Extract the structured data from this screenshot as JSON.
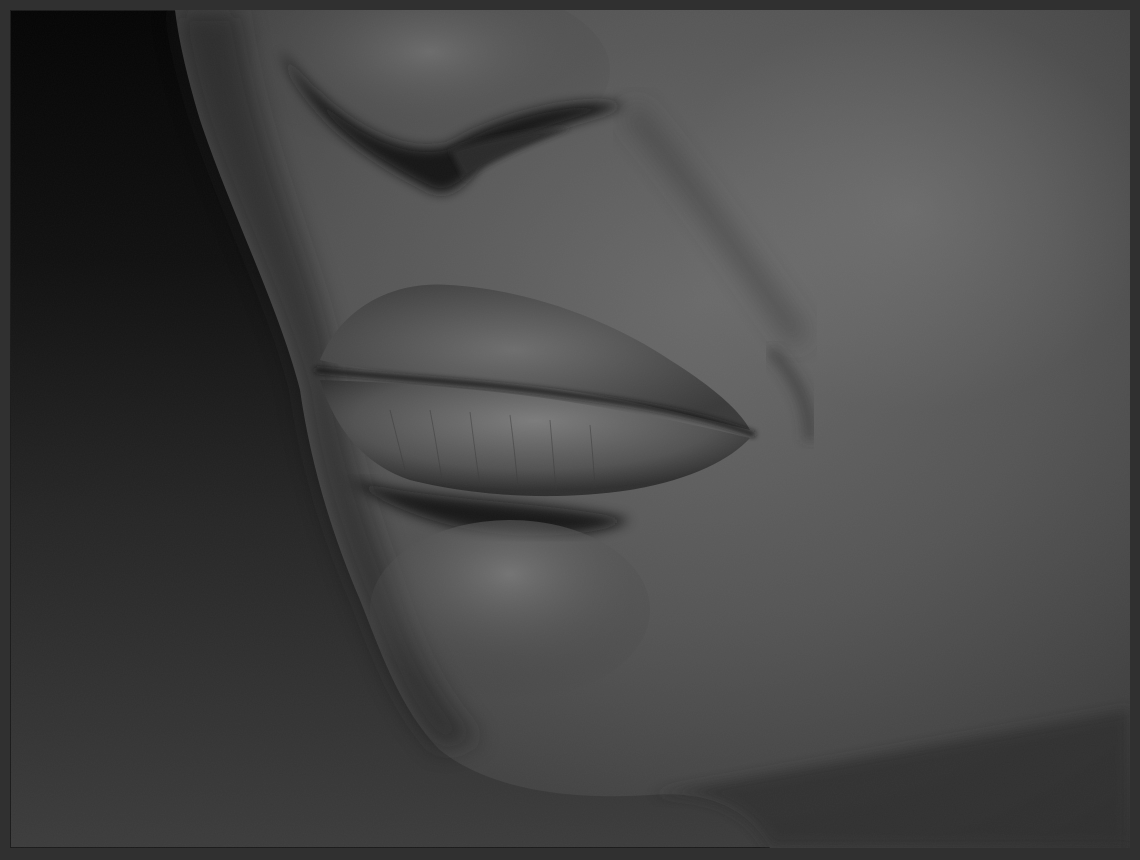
{
  "scene": {
    "subject": "sculpt-render",
    "icon": "sculpted-face-closeup",
    "colors": {
      "frame": "#303030",
      "background_top": "#040404",
      "background_bottom": "#3c3c3c",
      "skin_light": "#7a7a7a",
      "skin_mid": "#4e4e4e",
      "skin_dark": "#1e1e1e"
    }
  }
}
